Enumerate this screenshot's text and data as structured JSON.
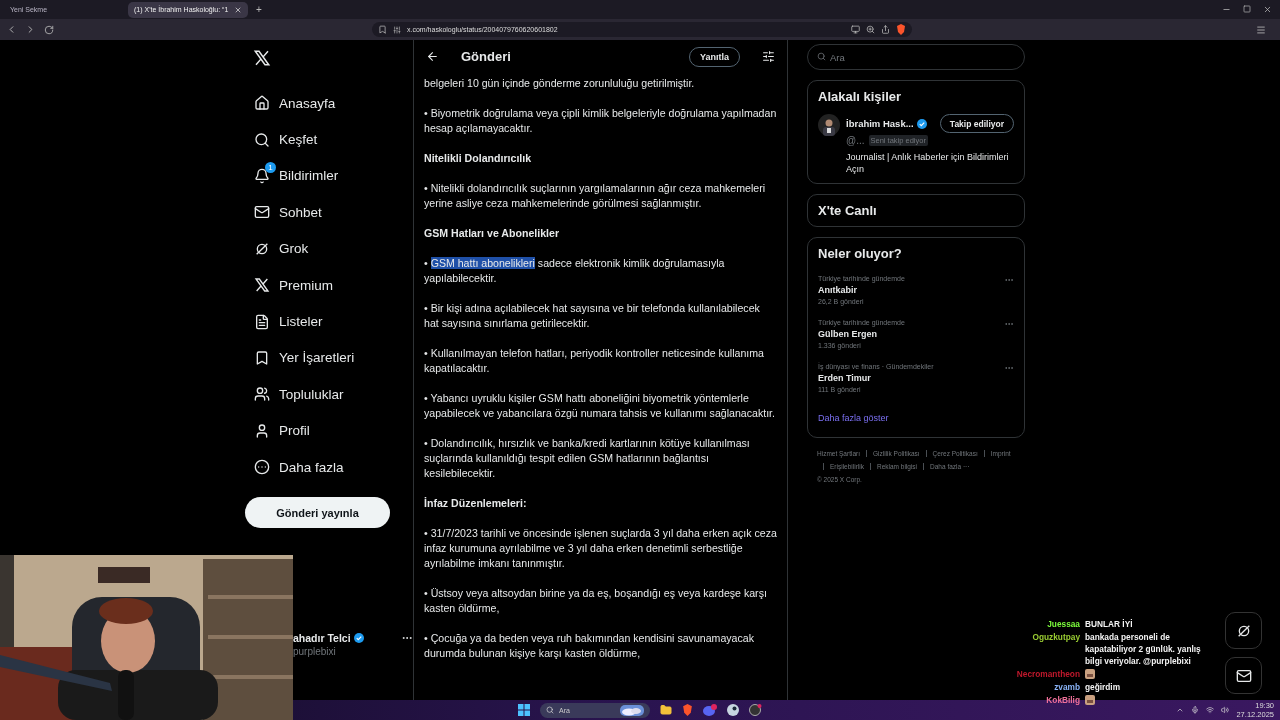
{
  "browser": {
    "tabs": [
      {
        "title": "Yeni Sekme",
        "selected": false
      },
      {
        "title": "(1) X'te İbrahim Haskoloğlu: “1",
        "selected": true
      }
    ],
    "new_tab": "+",
    "address": "x.com/haskologlu/status/2004079760620601802"
  },
  "nav": {
    "items": [
      {
        "label": "Anasayfa"
      },
      {
        "label": "Keşfet"
      },
      {
        "label": "Bildirimler",
        "badge": "1"
      },
      {
        "label": "Sohbet"
      },
      {
        "label": "Grok"
      },
      {
        "label": "Premium"
      },
      {
        "label": "Listeler"
      },
      {
        "label": "Yer İşaretleri"
      },
      {
        "label": "Topluluklar"
      },
      {
        "label": "Profil"
      },
      {
        "label": "Daha fazla"
      }
    ],
    "post_button": "Gönderi yayınla",
    "account": {
      "name": "ahadır Telci",
      "handle": "purplebixi"
    }
  },
  "post": {
    "title": "Gönderi",
    "reply_button": "Yanıtla",
    "blocks": [
      {
        "kind": "paragraph",
        "text": "belgeleri 10 gün içinde gönderme zorunluluğu getirilmiştir."
      },
      {
        "kind": "paragraph",
        "text": "• Biyometrik doğrulama veya çipli kimlik belgeleriyle doğrulama yapılmadan hesap açılamayacaktır."
      },
      {
        "kind": "heading",
        "text": "Nitelikli Dolandırıcılık"
      },
      {
        "kind": "paragraph",
        "text": "• Nitelikli dolandırıcılık suçlarının yargılamalarının ağır ceza mahkemeleri yerine asliye ceza mahkemelerinde görülmesi sağlanmıştır."
      },
      {
        "kind": "heading",
        "text": "GSM Hatları ve Abonelikler"
      },
      {
        "kind": "paragraph",
        "parts": [
          {
            "text": "• ",
            "selected": false
          },
          {
            "text": "GSM hattı abonelikleri",
            "selected": true
          },
          {
            "text": " sadece elektronik kimlik doğrulamasıyla yapılabilecektir.",
            "selected": false
          }
        ]
      },
      {
        "kind": "paragraph",
        "text": "• Bir kişi adına açılabilecek hat sayısına ve bir telefonda kullanılabilecek hat sayısına sınırlama getirilecektir."
      },
      {
        "kind": "paragraph",
        "text": "• Kullanılmayan telefon hatları, periyodik kontroller neticesinde kullanıma kapatılacaktır."
      },
      {
        "kind": "paragraph",
        "text": "• Yabancı uyruklu kişiler GSM hattı aboneliğini biyometrik yöntemlerle yapabilecek ve yabancılara özgü numara tahsis ve kullanımı sağlanacaktır."
      },
      {
        "kind": "paragraph",
        "text": "• Dolandırıcılık, hırsızlık ve banka/kredi kartlarının kötüye kullanılması suçlarında kullanıldığı tespit edilen GSM hatlarının bağlantısı kesilebilecektir."
      },
      {
        "kind": "heading",
        "text": "İnfaz Düzenlemeleri:"
      },
      {
        "kind": "paragraph",
        "text": "• 31/7/2023 tarihli ve öncesinde işlenen suçlarda 3 yıl daha erken açık ceza infaz kurumuna ayrılabilme ve 3 yıl daha erken denetimli serbestliğe ayrılabilme imkanı tanınmıştır."
      },
      {
        "kind": "paragraph",
        "text": "• Üstsoy veya altsoydan birine ya da eş, boşandığı eş veya kardeşe karşı kasten öldürme,"
      },
      {
        "kind": "paragraph",
        "text": "• Çocuğa ya da beden veya ruh bakımından kendisini savunamayacak durumda bulunan kişiye karşı kasten öldürme,"
      }
    ]
  },
  "sidebar": {
    "search": {
      "placeholder": "Ara"
    },
    "who_to_follow": {
      "title": "Alakalı kişiler",
      "person": {
        "name": "İbrahim Hask...",
        "handle": "@...",
        "follows_you": "Seni takip ediyor",
        "button": "Takip ediliyor",
        "bio": "Journalist | Anlık Haberler için Bildirimleri Açın"
      }
    },
    "live": {
      "title": "X'te Canlı"
    },
    "trends": {
      "title": "Neler oluyor?",
      "items": [
        {
          "context": "Türkiye tarihinde gündemde",
          "name": "Anıtkabir",
          "count": "26,2 B gönderi"
        },
        {
          "context": "Türkiye tarihinde gündemde",
          "name": "Gülben Ergen",
          "count": "1.336 gönderi"
        },
        {
          "context": "İş dünyası ve finans · Gündemdekiler",
          "name": "Erden Timur",
          "count": "111 B gönderi"
        }
      ],
      "show_more": "Daha fazla göster"
    },
    "footer": {
      "links": [
        "Hizmet Şartları",
        "Gizlilik Politikası",
        "Çerez Politikası",
        "Imprint",
        "Erişilebilirlik",
        "Reklam bilgisi",
        "Daha fazla ···"
      ],
      "copyright": "© 2025 X Corp."
    }
  },
  "chat": {
    "messages": [
      {
        "user": "Juessaa",
        "color": "#7cfc3c",
        "kind": "text",
        "text": "BUNLAR İYİ"
      },
      {
        "user": "Oguzkutpay",
        "color": "#9acd32",
        "kind": "text",
        "text": "bankada personeli de kapatabiliyor 2 günlük. yanlış bilgi veriyolar. @purplebixi"
      },
      {
        "user": "Necromantheon",
        "color": "#c0182c",
        "kind": "emote"
      },
      {
        "user": "zvamb",
        "color": "#8ab4f8",
        "kind": "text",
        "text": "geğirdim"
      },
      {
        "user": "KokBilig",
        "color": "#f0709a",
        "kind": "emote"
      }
    ]
  },
  "taskbar": {
    "search": "Ara",
    "time": "19:30",
    "date": "27.12.2025"
  }
}
